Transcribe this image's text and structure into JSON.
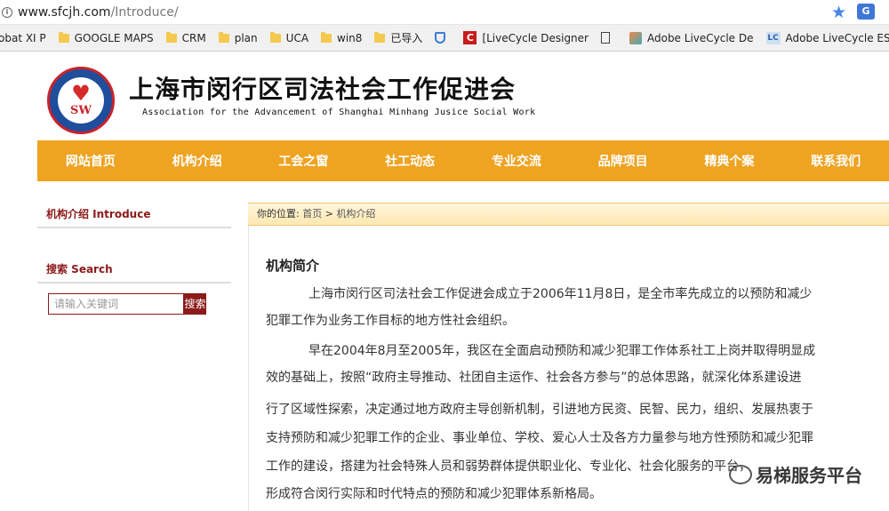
{
  "browser": {
    "url_host": "www.sfcjh.com",
    "url_path": "/Introduce/",
    "bookmarks": [
      {
        "label": "obat XI P",
        "icon": "folder-icon"
      },
      {
        "label": "GOOGLE MAPS",
        "icon": "folder-icon"
      },
      {
        "label": "CRM",
        "icon": "folder-icon"
      },
      {
        "label": "plan",
        "icon": "folder-icon"
      },
      {
        "label": "UCA",
        "icon": "folder-icon"
      },
      {
        "label": "win8",
        "icon": "folder-icon"
      },
      {
        "label": "已导入",
        "icon": "folder-icon"
      },
      {
        "label": "",
        "icon": "shield-icon"
      },
      {
        "label": "[LiveCycle Designer",
        "icon": "livecycle-red-icon"
      },
      {
        "label": "",
        "icon": "document-icon"
      },
      {
        "label": "Adobe LiveCycle De",
        "icon": "adobe-icon"
      },
      {
        "label": "Adobe LiveCycle ES",
        "icon": "lc-blue-icon"
      }
    ]
  },
  "site": {
    "title": "上海市闵行区司法社会工作促进会",
    "subtitle": "Association for the Advancement of Shanghai Minhang Jusice Social Work",
    "logo_text": "SW"
  },
  "nav": [
    "网站首页",
    "机构介绍",
    "工会之窗",
    "社工动态",
    "专业交流",
    "品牌项目",
    "精典个案",
    "联系我们"
  ],
  "sidebar": {
    "intro_heading": "机构介绍 Introduce",
    "search_heading": "搜索 Search",
    "search_placeholder": "请输入关键词",
    "search_button": "搜索"
  },
  "breadcrumb": {
    "prefix": "你的位置:",
    "home": "首页",
    "sep": ">",
    "current": "机构介绍"
  },
  "content": {
    "section_title": "机构简介",
    "lines": [
      "上海市闵行区司法社会工作促进会成立于2006年11月8日，是全市率先成立的以预防和减少",
      "犯罪工作为业务工作目标的地方性社会组织。",
      "早在2004年8月至2005年，我区在全面启动预防和减少犯罪工作体系社工上岗并取得明显成",
      "效的基础上，按照“政府主导推动、社团自主运作、社会各方参与”的总体思路，就深化体系建设进",
      "行了区域性探索，决定通过地方政府主导创新机制，引进地方民资、民智、民力，组织、发展热衷于",
      "支持预防和减少犯罪工作的企业、事业单位、学校、爱心人士及各方力量参与地方性预防和减少犯罪",
      "工作的建设，搭建为社会特殊人员和弱势群体提供职业化、专业化、社会化服务的平台，",
      "形成符合闵行实际和时代特点的预防和减少犯罪体系新格局。"
    ]
  },
  "watermark": "易梯服务平台",
  "colors": {
    "nav": "#eea321",
    "brand_red": "#8b1a1a",
    "breadcrumb_bg": "#fde8b0"
  }
}
